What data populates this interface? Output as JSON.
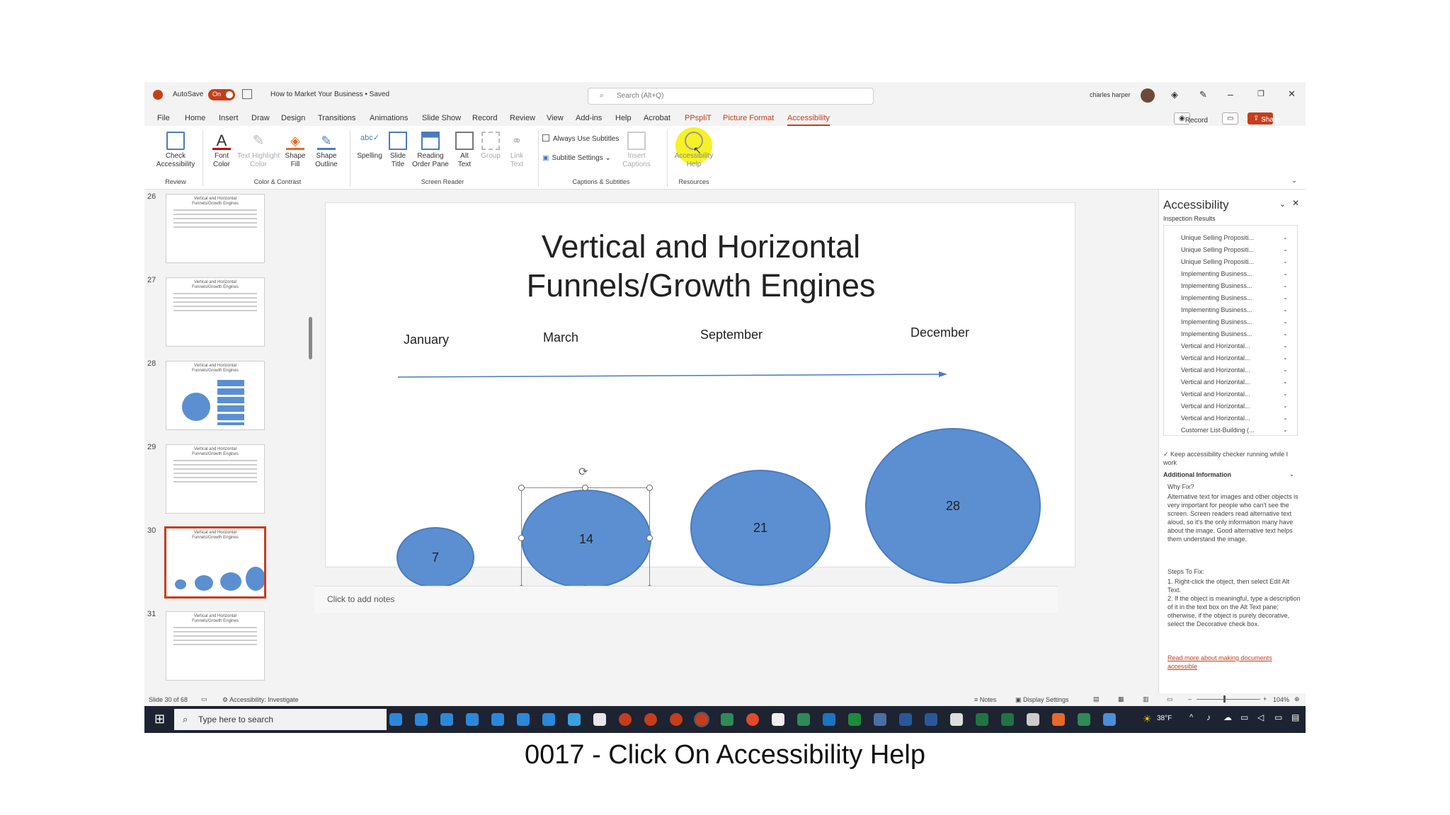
{
  "titlebar": {
    "autosave": "AutoSave",
    "autosave_state": "On",
    "doc_title": "How to Market Your Business • Saved",
    "search_placeholder": "Search (Alt+Q)",
    "user": "charles harper"
  },
  "menu": [
    "File",
    "Home",
    "Insert",
    "Draw",
    "Design",
    "Transitions",
    "Animations",
    "Slide Show",
    "Record",
    "Review",
    "View",
    "Add-ins",
    "Help",
    "Acrobat",
    "PPspliT",
    "Picture Format",
    "Accessibility"
  ],
  "record_label": "Record",
  "share_label": "Share",
  "ribbon": {
    "check": "Check\nAccessibility",
    "font_color": "Font\nColor",
    "text_highlight": "Text Highlight\nColor",
    "shape_fill": "Shape\nFill",
    "shape_outline": "Shape\nOutline",
    "spelling": "Spelling",
    "slide_title": "Slide\nTitle",
    "reading_order": "Reading\nOrder Pane",
    "alt_text": "Alt\nText",
    "group": "Group",
    "link_text": "Link\nText",
    "always_subtitles": "Always Use Subtitles",
    "subtitle_settings": "Subtitle Settings",
    "insert_captions": "Insert\nCaptions",
    "accessibility_help": "Accessibility\nHelp",
    "groups": {
      "review": "Review",
      "color_contrast": "Color & Contrast",
      "screen_reader": "Screen Reader",
      "captions": "Captions & Subtitles",
      "resources": "Resources"
    }
  },
  "thumbnails": {
    "numbers": [
      "26",
      "27",
      "28",
      "29",
      "30",
      "31"
    ],
    "title": "Vertical and Horizontal\nFunnels/Growth Engines"
  },
  "slide": {
    "title_line1": "Vertical and Horizontal",
    "title_line2": "Funnels/Growth Engines",
    "months": [
      "January",
      "March",
      "September",
      "December"
    ],
    "circles": [
      "7",
      "14",
      "21",
      "28"
    ]
  },
  "notes_placeholder": "Click to add notes",
  "accessibility_pane": {
    "title": "Accessibility",
    "inspection": "Inspection Results",
    "items": [
      "Unique Selling Propositi...",
      "Unique Selling Propositi...",
      "Unique Selling Propositi...",
      "Implementing Business...",
      "Implementing Business...",
      "Implementing Business...",
      "Implementing Business...",
      "Implementing Business...",
      "Implementing Business...",
      "Vertical and Horizontal...",
      "Vertical and Horizontal...",
      "Vertical and Horizontal...",
      "Vertical and Horizontal...",
      "Vertical and Horizontal...",
      "Vertical and Horizontal...",
      "Vertical and Horizontal...",
      "Customer List-Building (..."
    ],
    "keep_running": "Keep accessibility checker running while I work",
    "additional": "Additional Information",
    "why_fix": "Why Fix?",
    "why_text": "Alternative text for images and other objects is very important for people who can't see the screen. Screen readers read alternative text aloud, so it's the only information many have about the image. Good alternative text helps them understand the image.",
    "steps": "Steps To Fix:",
    "step1": "1. Right-click the object, then select Edit Alt Text.",
    "step2": "2. If the object is meaningful, type a description of it in the text box on the Alt Text pane; otherwise, if the object is purely decorative, select the Decorative check box.",
    "link": "Read more about making documents accessible"
  },
  "status": {
    "slide": "Slide 30 of 68",
    "accessibility": "Accessibility: Investigate",
    "notes": "Notes",
    "display": "Display Settings",
    "zoom": "104%"
  },
  "taskbar": {
    "search": "Type here to search",
    "temp": "38°F"
  },
  "caption": "0017 - Click On Accessibility Help"
}
